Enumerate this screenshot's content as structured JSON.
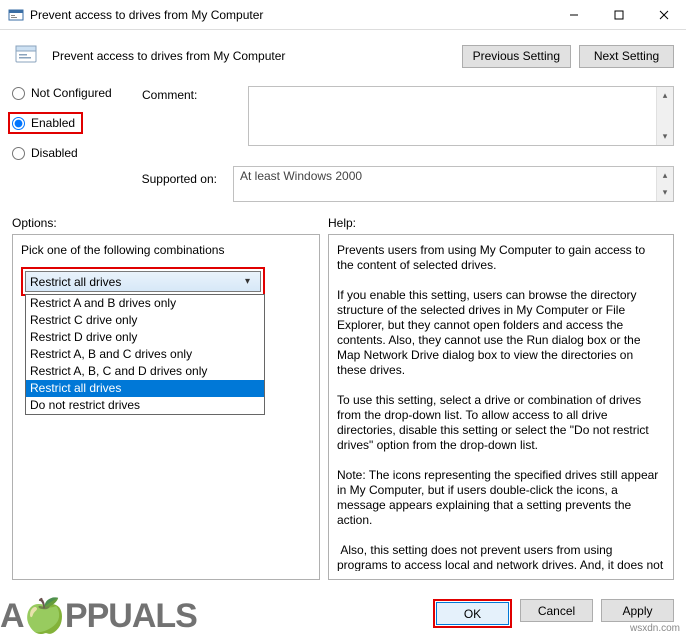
{
  "window": {
    "title": "Prevent access to drives from My Computer"
  },
  "header": {
    "policy_title": "Prevent access to drives from My Computer",
    "prev_btn": "Previous Setting",
    "next_btn": "Next Setting"
  },
  "state": {
    "not_configured": "Not Configured",
    "enabled": "Enabled",
    "disabled": "Disabled",
    "selected": "enabled"
  },
  "comment": {
    "label": "Comment:",
    "value": ""
  },
  "supported": {
    "label": "Supported on:",
    "value": "At least Windows 2000"
  },
  "labels": {
    "options": "Options:",
    "help": "Help:"
  },
  "options": {
    "pick_label": "Pick one of the following combinations",
    "selected": "Restrict all drives",
    "items": [
      "Restrict A and B drives only",
      "Restrict C drive only",
      "Restrict D drive only",
      "Restrict A, B and C drives only",
      "Restrict A, B, C and D drives only",
      "Restrict all drives",
      "Do not restrict drives"
    ]
  },
  "help": {
    "text": "Prevents users from using My Computer to gain access to the content of selected drives.\n\nIf you enable this setting, users can browse the directory structure of the selected drives in My Computer or File Explorer, but they cannot open folders and access the contents. Also, they cannot use the Run dialog box or the Map Network Drive dialog box to view the directories on these drives.\n\nTo use this setting, select a drive or combination of drives from the drop-down list. To allow access to all drive directories, disable this setting or select the \"Do not restrict drives\" option from the drop-down list.\n\nNote: The icons representing the specified drives still appear in My Computer, but if users double-click the icons, a message appears explaining that a setting prevents the action.\n\n Also, this setting does not prevent users from using programs to access local and network drives. And, it does not prevent them from using the Disk Management snap-in to view and change"
  },
  "footer": {
    "ok": "OK",
    "cancel": "Cancel",
    "apply": "Apply"
  },
  "watermark": "wsxdn.com",
  "logo": {
    "part1": "A",
    "part2": "PPUALS"
  }
}
